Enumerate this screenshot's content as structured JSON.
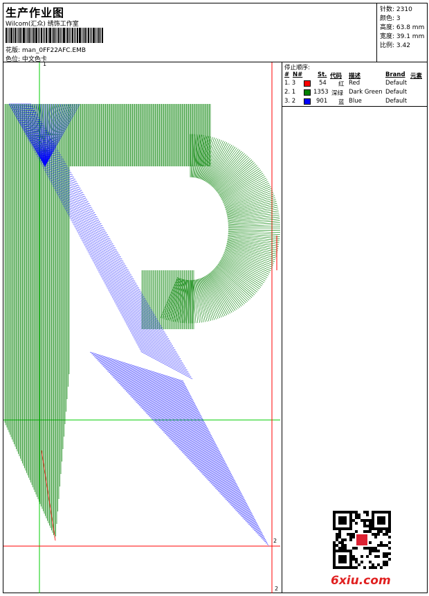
{
  "header": {
    "title": "生产作业图",
    "studio": "Wilcom(汇众) 绣饰工作室",
    "pattern_label": "花版: ",
    "pattern_value": "man_0FF22AFC.EMB",
    "colorpos_label": "色位: ",
    "colorpos_value": "中文色卡"
  },
  "stats": {
    "stitches_label": "针数: ",
    "stitches_value": "2310",
    "colors_label": "颜色: ",
    "colors_value": "3",
    "height_label": "高度: ",
    "height_value": "63.8 mm",
    "width_label": "宽度: ",
    "width_value": "39.1 mm",
    "ratio_label": "比例: ",
    "ratio_value": "3.42"
  },
  "sequence": {
    "title": "停止顺序:",
    "headers": [
      "#",
      "N#",
      "St.",
      "代码",
      "描述",
      "Brand",
      "元素"
    ],
    "rows": [
      {
        "idx": "1. 3",
        "stitches": "54",
        "code": "红",
        "desc": "Red",
        "brand": "Default",
        "color": "#ff0000"
      },
      {
        "idx": "2. 1",
        "stitches": "1353",
        "code": "深绿",
        "desc": "Dark Green",
        "brand": "Default",
        "color": "#008000"
      },
      {
        "idx": "3. 2",
        "stitches": "901",
        "code": "蓝",
        "desc": "Blue",
        "brand": "Default",
        "color": "#0000ff"
      }
    ]
  },
  "canvas": {
    "marker_top": "1",
    "marker_mid": "2",
    "marker_bottom": "2",
    "green_color": "#008000",
    "blue_color": "#0000ff",
    "red_color": "#ff0000",
    "guide_green": "#00cc00"
  },
  "watermark": "6xiu.com",
  "qr_label": "qr-code"
}
